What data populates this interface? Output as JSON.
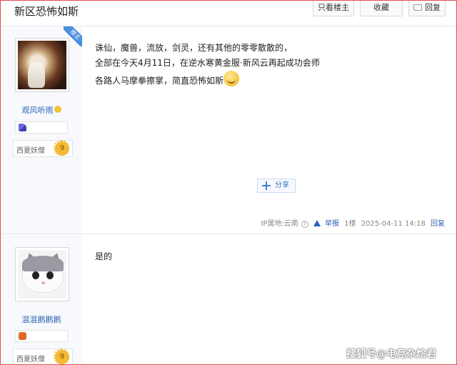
{
  "header": {
    "title": "新区恐怖如斯",
    "only_op_label": "只看楼主",
    "favorite_label": "收藏",
    "reply_label": "回复"
  },
  "posts": [
    {
      "ribbon": "楼主",
      "username": "观风听雨",
      "level_title": "西夏妖僧",
      "level": "9",
      "lines": [
        "诛仙，魔兽，流放，剑灵，还有其他的零零散散的，",
        "全部在今天4月11日，在逆水寒黄金服·新风云再起成功会师",
        "各路人马摩拳擦掌，简直恐怖如斯"
      ],
      "share_label": "分享",
      "ip_label": "IP属地:云南",
      "report_label": "举报",
      "floor": "1楼",
      "time": "2025-04-11 14:18",
      "reply_label": "回复"
    },
    {
      "username": "混混鹅鹅鹅",
      "level_title": "西夏妖僧",
      "level": "9",
      "lines": [
        "是的"
      ]
    }
  ],
  "watermark": "搜狐号@电竞杂烩君",
  "colors": {
    "link": "#2d64b3",
    "frame_border": "#e05050",
    "sidebar_bg": "#f7f9fc"
  }
}
